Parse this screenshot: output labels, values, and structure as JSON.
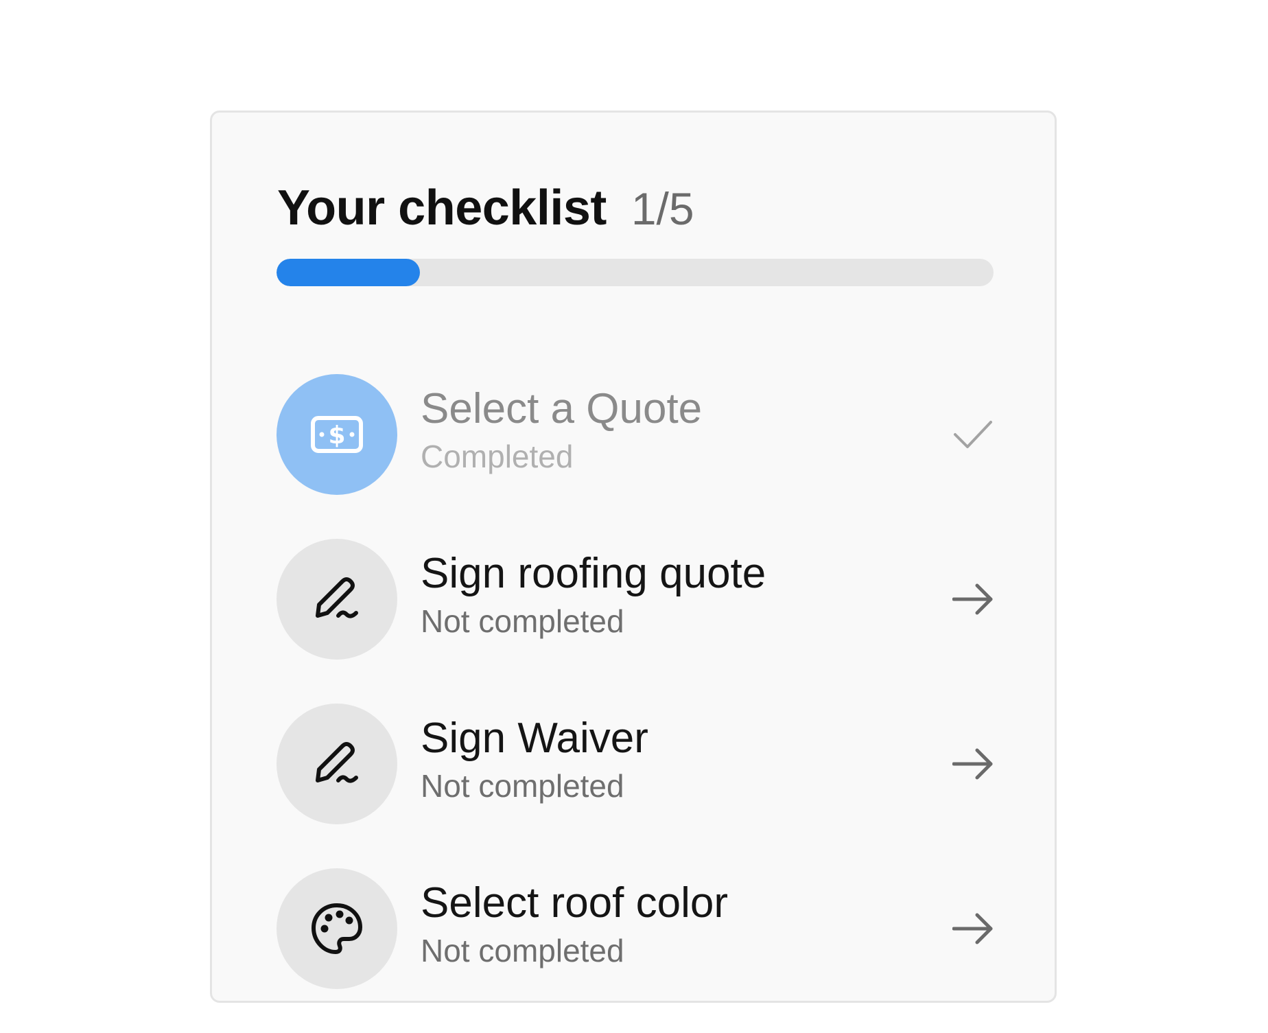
{
  "checklist": {
    "title": "Your checklist",
    "count": "1/5",
    "progress_fraction": 0.2,
    "accent_color": "#2483ea",
    "items": [
      {
        "title": "Select a Quote",
        "status": "Completed",
        "icon": "dollar-bill-icon",
        "done": true
      },
      {
        "title": "Sign roofing quote",
        "status": "Not completed",
        "icon": "signature-pen-icon",
        "done": false
      },
      {
        "title": "Sign Waiver",
        "status": "Not completed",
        "icon": "signature-pen-icon",
        "done": false
      },
      {
        "title": "Select roof color",
        "status": "Not completed",
        "icon": "palette-icon",
        "done": false
      }
    ]
  }
}
